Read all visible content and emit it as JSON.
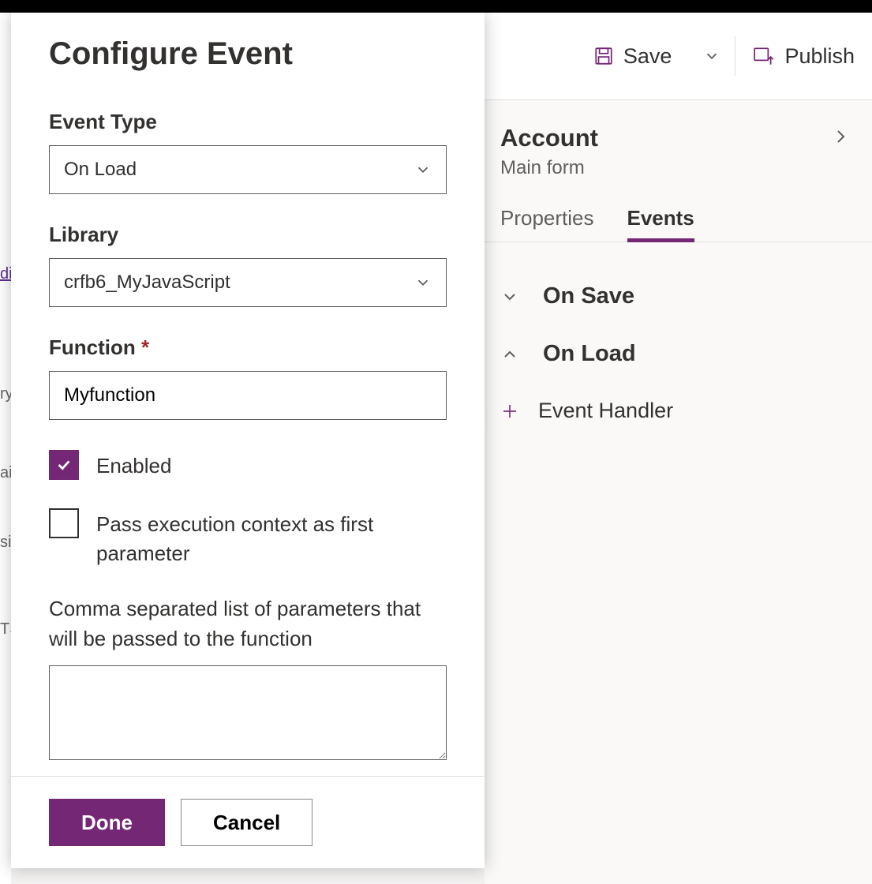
{
  "commandbar": {
    "save_label": "Save",
    "publish_label": "Publish"
  },
  "sidepanel": {
    "title": "Account",
    "subtitle": "Main form",
    "tabs": {
      "properties": "Properties",
      "events": "Events"
    },
    "active_tab": "events",
    "sections": {
      "on_save": "On Save",
      "on_load": "On Load"
    },
    "add_handler": "Event Handler"
  },
  "modal": {
    "title": "Configure Event",
    "event_type_label": "Event Type",
    "event_type_value": "On Load",
    "library_label": "Library",
    "library_value": "crfb6_MyJavaScript",
    "function_label": "Function",
    "function_value": "Myfunction",
    "enabled_label": "Enabled",
    "enabled_checked": true,
    "pass_context_label": "Pass execution context as first parameter",
    "pass_context_checked": false,
    "params_label": "Comma separated list of parameters that will be passed to the function",
    "params_value": "",
    "done_label": "Done",
    "cancel_label": "Cancel"
  },
  "colors": {
    "accent": "#742774"
  },
  "leftgutter": {
    "link": "di",
    "t1": "ry",
    "t2": "ai",
    "t3": "sir",
    "t4": "TS"
  }
}
